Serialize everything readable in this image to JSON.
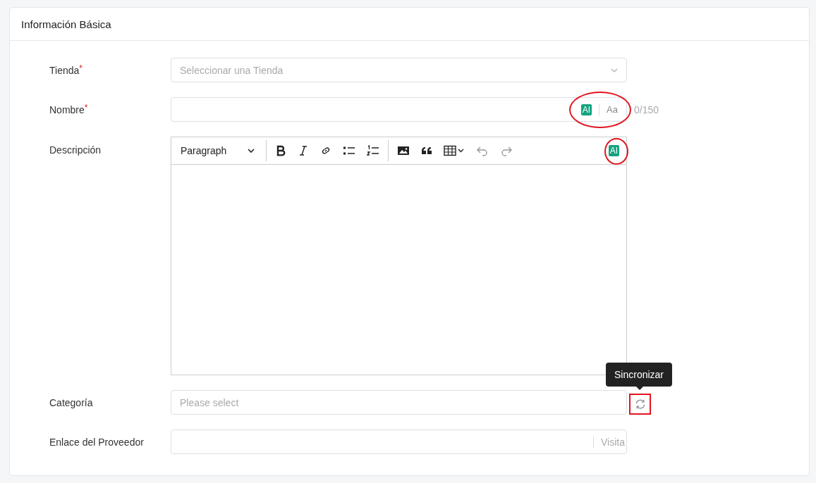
{
  "card": {
    "title": "Información Básica"
  },
  "fields": [
    {
      "kind": "select",
      "label": "Tienda",
      "required_mark": "*",
      "placeholder": "Seleccionar una Tienda"
    },
    {
      "kind": "text",
      "label": "Nombre",
      "required_mark": "*",
      "ai_badge": "AI",
      "case_button": "Aa",
      "counter": "0/150"
    },
    {
      "kind": "editor",
      "label": "Descripción",
      "format": "Paragraph",
      "ai_badge": "AI"
    },
    {
      "kind": "category",
      "label": "Categoría",
      "placeholder": "Please select",
      "tooltip": "Sincronizar"
    },
    {
      "kind": "link",
      "label": "Enlace del Proveedor",
      "suffix": "Visita"
    }
  ]
}
